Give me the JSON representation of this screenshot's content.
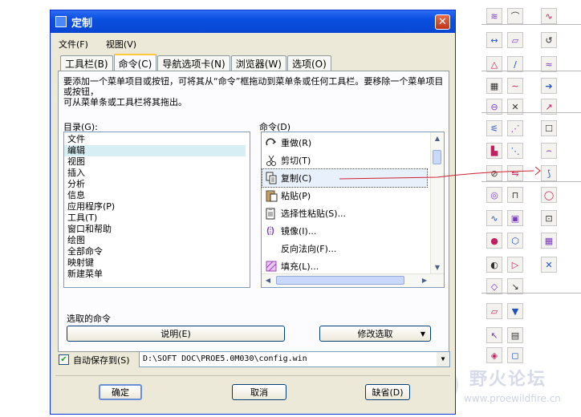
{
  "dialog": {
    "title": "定制",
    "close_glyph": "✕",
    "menu": [
      "文件(F)",
      "视图(V)"
    ],
    "tabs": [
      "工具栏(B)",
      "命令(C)",
      "导航选项卡(N)",
      "浏览器(W)",
      "选项(O)"
    ],
    "active_tab": 1,
    "description": "要添加一个菜单项目或按钮，可将其从“命令”框拖动到菜单条或任何工具栏。要移除一个菜单项目或按钮，\n可从菜单条或工具栏将其拖出。",
    "categories_label": "目录(G):",
    "categories": [
      "文件",
      "编辑",
      "视图",
      "插入",
      "分析",
      "信息",
      "应用程序(P)",
      "工具(T)",
      "窗口和帮助",
      "绘图",
      "全部命令",
      "映射键",
      "新建菜单"
    ],
    "selected_category": 1,
    "commands_label": "命令(D)",
    "commands": [
      {
        "label": "重做(R)",
        "icon": "redo-icon"
      },
      {
        "label": "剪切(T)",
        "icon": "scissors-icon"
      },
      {
        "label": "复制(C)",
        "icon": "copy-icon"
      },
      {
        "label": "粘贴(P)",
        "icon": "paste-icon"
      },
      {
        "label": "选择性粘贴(S)...",
        "icon": "paste-special-icon"
      },
      {
        "label": "镜像(I)...",
        "icon": "mirror-icon"
      },
      {
        "label": "反向法向(F)...",
        "icon": ""
      },
      {
        "label": "填充(L)...",
        "icon": "fill-icon"
      }
    ],
    "selected_command": 2,
    "selected_commands_label": "选取的命令",
    "explain_button": "说明(E)",
    "modify_button": "修改选取",
    "autosave_label": "自动保存到(S)",
    "autosave_checked": true,
    "autosave_path": "D:\\SOFT DOC\\PROE5.0M030\\config.win",
    "ok_button": "确定",
    "cancel_button": "取消",
    "default_button": "缺省(D)"
  },
  "watermark": {
    "title": "野火论坛",
    "url": "www.proewildfire.cn"
  },
  "colors": {
    "titlebar": "#0a4fe0",
    "dialog_bg": "#ece9d8",
    "drag_line": "#d02030"
  }
}
